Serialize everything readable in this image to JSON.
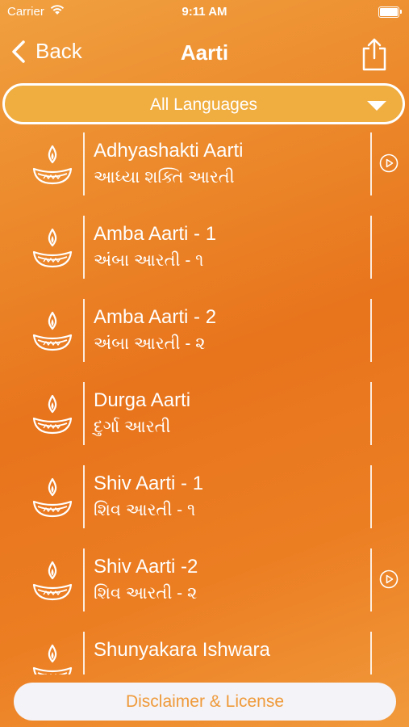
{
  "status": {
    "carrier": "Carrier",
    "time": "9:11 AM"
  },
  "nav": {
    "back_label": "Back",
    "title": "Aarti"
  },
  "language_select": {
    "selected": "All Languages"
  },
  "items": [
    {
      "en": "Adhyashakti Aarti",
      "gu": "આધ્યા શક્તિ આરતી",
      "has_play": true
    },
    {
      "en": "Amba Aarti - 1",
      "gu": "અંબા આરતી - ૧",
      "has_play": false
    },
    {
      "en": "Amba Aarti - 2",
      "gu": "અંબા આરતી - ૨",
      "has_play": false
    },
    {
      "en": "Durga Aarti",
      "gu": "દુર્ગા આરતી",
      "has_play": false
    },
    {
      "en": "Shiv Aarti - 1",
      "gu": "શિવ આરતી - ૧",
      "has_play": false
    },
    {
      "en": "Shiv Aarti -2",
      "gu": "શિવ આરતી - ૨",
      "has_play": true
    },
    {
      "en": "Shunyakara Ishwara",
      "gu": "",
      "has_play": false
    }
  ],
  "footer": {
    "disclaimer_label": "Disclaimer & License"
  },
  "colors": {
    "accent": "#ef9a3a",
    "background_top": "#f0a040",
    "background_mid": "#e8741c"
  }
}
